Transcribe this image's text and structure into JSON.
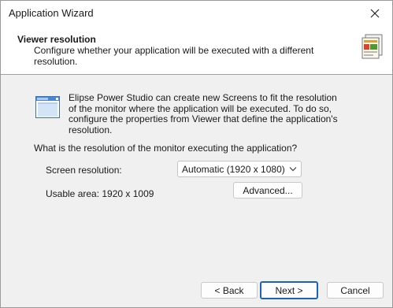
{
  "window": {
    "title": "Application Wizard"
  },
  "header": {
    "title": "Viewer resolution",
    "subtitle": "Configure whether your application will be executed with a different resolution.",
    "icon": "wizard-documents-icon"
  },
  "info": {
    "icon": "application-window-icon",
    "text": "Elipse Power Studio can create new Screens to fit the resolution of the monitor where the application will be executed. To do so, configure the properties from Viewer that define the application's resolution."
  },
  "form": {
    "question": "What is the resolution of the monitor executing the application?",
    "resolution_label": "Screen resolution:",
    "resolution_value": "Automatic (1920 x 1080)",
    "usable_area": "Usable area: 1920 x 1009",
    "advanced_label": "Advanced..."
  },
  "footer": {
    "back_label": "< Back",
    "next_label": "Next >",
    "cancel_label": "Cancel"
  },
  "colors": {
    "accent": "#1c63b6",
    "background": "#f0f0f0",
    "header_bg": "#ffffff"
  }
}
